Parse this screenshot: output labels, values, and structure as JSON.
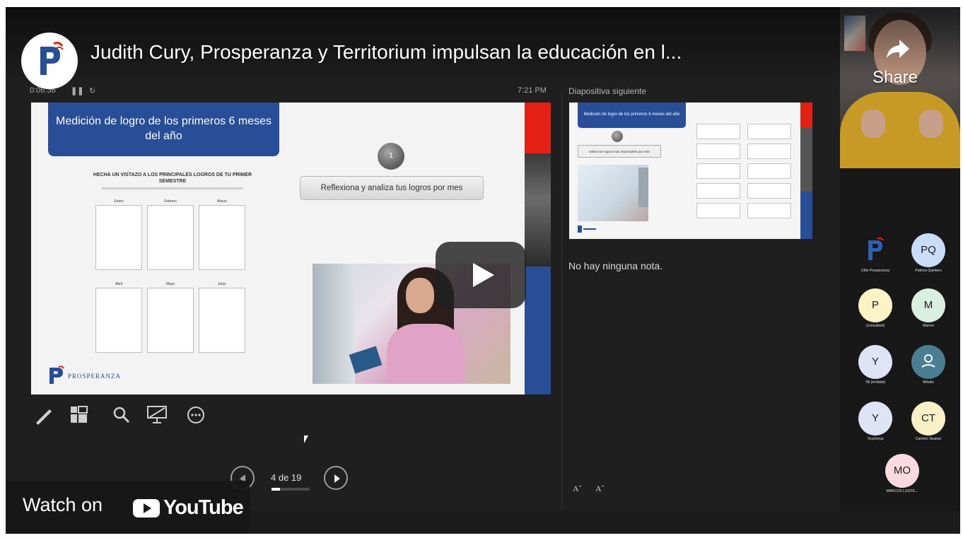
{
  "video": {
    "title": "Judith Cury, Prosperanza y Territorium impulsan la educación en l...",
    "share_label": "Share",
    "watch_on_label": "Watch on",
    "youtube_label": "YouTube",
    "play_button": "play-icon",
    "channel_logo": "prosperanza-logo"
  },
  "presenter": {
    "elapsed_time": "0:06:36",
    "clock": "7:21 PM",
    "next_slide_label": "Diapositiva siguiente",
    "notes_text": "No hay ninguna nota.",
    "slide_counter": "4 de 19",
    "slide_index": 4,
    "slide_total": 19,
    "tools": [
      "pen-icon",
      "slides-grid-icon",
      "zoom-icon",
      "screen-icon",
      "more-icon"
    ],
    "font_decrease": "Aˇ",
    "font_increase": "Aˆ"
  },
  "slide": {
    "title": "Medición de logro de los primeros 6 meses del año",
    "worksheet_heading": "HECHA UN VISTAZO A LOS PRINCIPALES LOGROS DE TU PRIMER SEMESTRE",
    "months": [
      "Enero",
      "Febrero",
      "Marzo",
      "Abril",
      "Mayo",
      "Junio"
    ],
    "step_number": "1",
    "instruction": "Reflexiona y analiza tus logros por mes",
    "brand": "PROSPERANZA"
  },
  "next_slide": {
    "title": "Medición de logro de los primeros 6 meses del año",
    "instruction": "Define los logros más importantes por mes"
  },
  "participants": [
    {
      "initials": "",
      "name": "UMx Prosperanza",
      "color": "logo"
    },
    {
      "initials": "PQ",
      "name": "Patricia Quintero",
      "color": "#c9dcf8"
    },
    {
      "initials": "P",
      "name": "(consultant)",
      "color": "#faf3c6"
    },
    {
      "initials": "M",
      "name": "Manrre",
      "color": "#d9efe0"
    },
    {
      "initials": "Y",
      "name": "Yili (invitado)",
      "color": "#dfe3f6"
    },
    {
      "initials": "",
      "name": "Miledis",
      "color": "#4a7f92"
    },
    {
      "initials": "Y",
      "name": "Yeselonya",
      "color": "#dfe3f6"
    },
    {
      "initials": "CT",
      "name": "Carmen Tavarez",
      "color": "#faf0c6"
    },
    {
      "initials": "MO",
      "name": "MARCOS LUISTE...",
      "color": "#fadadf"
    }
  ],
  "colors": {
    "brand_blue": "#274e96",
    "brand_red": "#e32012",
    "background": "#1b1b1b"
  }
}
